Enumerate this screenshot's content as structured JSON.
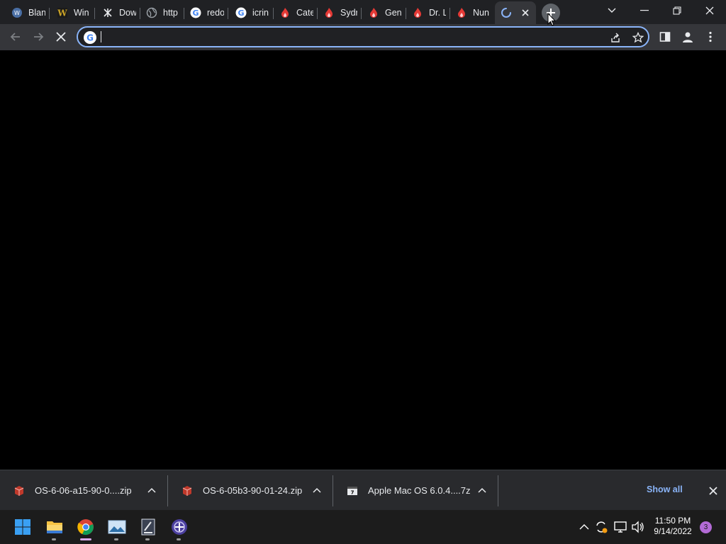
{
  "tabs": [
    {
      "title": "Blan",
      "icon": "blank-site-icon",
      "color": "#4a6fa5"
    },
    {
      "title": "Win",
      "icon": "w-logo-icon",
      "color": "#c9a227"
    },
    {
      "title": "Dow",
      "icon": "download-site-icon",
      "color": "#e8eaed"
    },
    {
      "title": "http",
      "icon": "globe-icon",
      "color": "#9aa0a6"
    },
    {
      "title": "redo",
      "icon": "google-icon",
      "color": "#ffffff"
    },
    {
      "title": "icrin",
      "icon": "google-icon",
      "color": "#ffffff"
    },
    {
      "title": "Cate",
      "icon": "flame-icon",
      "color": "#e53935"
    },
    {
      "title": "Sydr",
      "icon": "flame-icon",
      "color": "#e53935"
    },
    {
      "title": "Gen",
      "icon": "flame-icon",
      "color": "#e53935"
    },
    {
      "title": "Dr. L",
      "icon": "flame-icon",
      "color": "#e53935"
    },
    {
      "title": "Nun",
      "icon": "flame-icon",
      "color": "#e53935"
    }
  ],
  "active_tab": {
    "icon": "loading-spinner-icon",
    "title": ""
  },
  "omnibox": {
    "value": "",
    "placeholder": ""
  },
  "downloads": [
    {
      "name": "OS-6-06-a15-90-0....zip",
      "icon": "zip-archive-icon"
    },
    {
      "name": "OS-6-05b3-90-01-24.zip",
      "icon": "zip-archive-icon"
    },
    {
      "name": "Apple Mac OS 6.0.4....7z",
      "icon": "7z-archive-icon"
    }
  ],
  "downloads_bar": {
    "show_all": "Show all"
  },
  "taskbar": {
    "time": "11:50 PM",
    "date": "9/14/2022",
    "notification_count": "3"
  },
  "colors": {
    "accent": "#8ab4f8",
    "tabstrip": "#202124",
    "toolbar": "#35363a",
    "download_bar": "#292a2d",
    "taskbar": "#1c1c1c",
    "badge": "#b36bd6"
  }
}
